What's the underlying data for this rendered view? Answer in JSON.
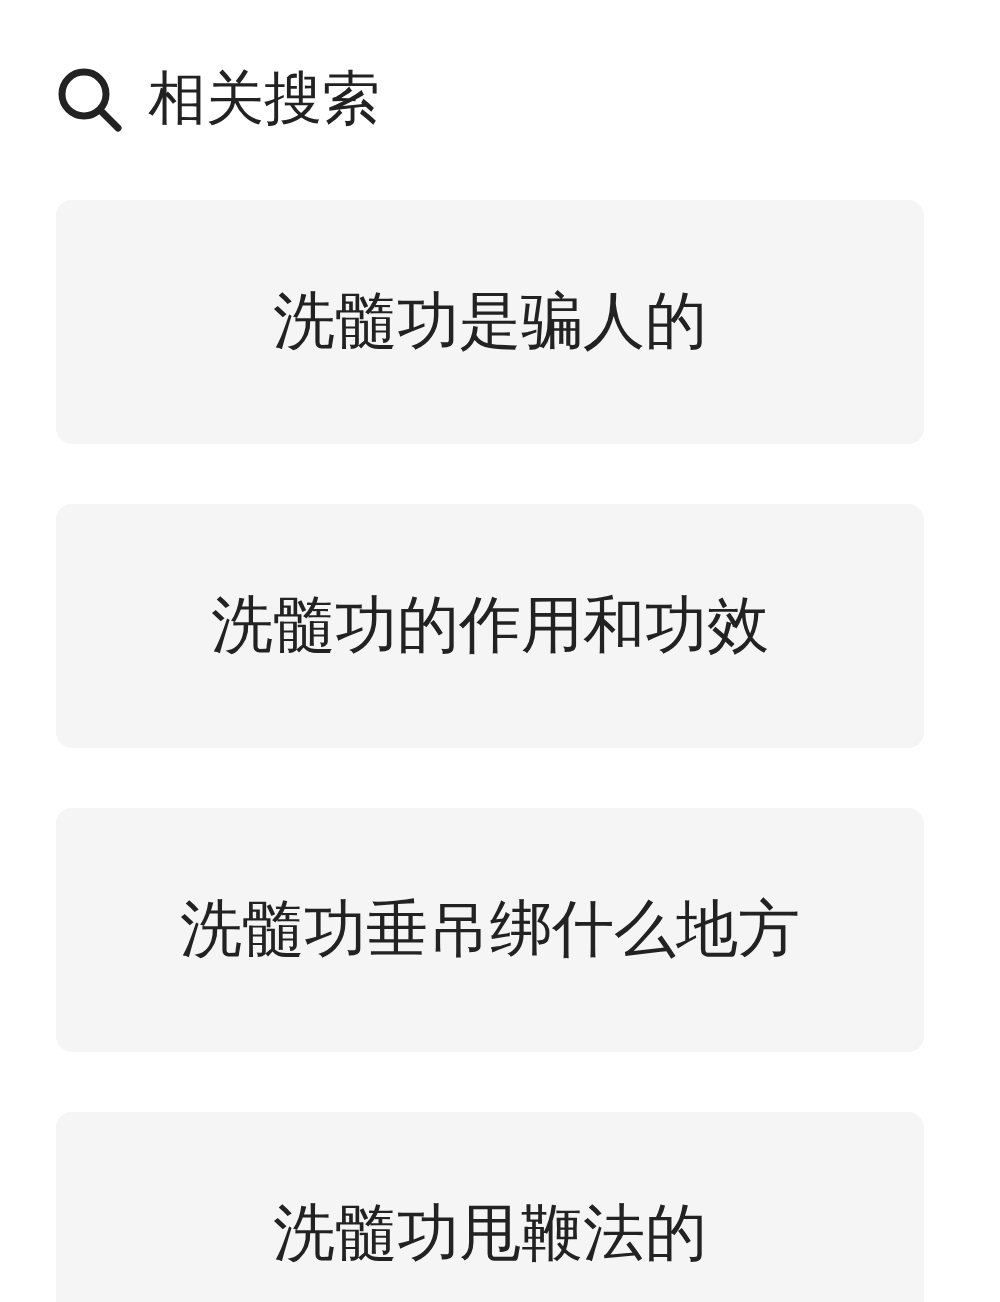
{
  "header": {
    "title": "相关搜索"
  },
  "suggestions": [
    {
      "text": "洗髓功是骗人的"
    },
    {
      "text": "洗髓功的作用和功效"
    },
    {
      "text": "洗髓功垂吊绑什么地方"
    },
    {
      "text": "洗髓功甩鞭法的"
    }
  ]
}
